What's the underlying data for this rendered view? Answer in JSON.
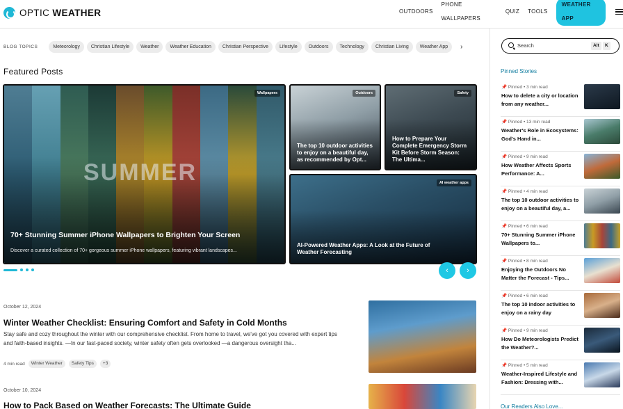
{
  "header": {
    "logo_light": "OPTIC ",
    "logo_bold": "WEATHER",
    "nav": [
      "OUTDOORS",
      "PHONE WALLPAPERS",
      "QUIZ",
      "TOOLS"
    ],
    "cta": "WEATHER APP"
  },
  "topics": {
    "label": "BLOG TOPICS",
    "chips": [
      "Meteorology",
      "Christian Lifestyle",
      "Weather",
      "Weather Education",
      "Christian Perspective",
      "Lifestyle",
      "Outdoors",
      "Technology",
      "Christian Living",
      "Weather App"
    ]
  },
  "featured": {
    "title": "Featured Posts",
    "main": {
      "badge": "Wallpapers",
      "image_word": "SUMMER",
      "title": "70+ Stunning Summer iPhone Wallpapers to Brighten Your Screen",
      "desc": "Discover a curated collection of 70+ gorgeous summer iPhone wallpapers, featuring vibrant landscapes..."
    },
    "card2": {
      "badge": "Outdoors",
      "title": "The top 10 outdoor activities to enjoy on a beautiful day, as recommended by Opt..."
    },
    "card3": {
      "badge": "Safety",
      "title": "How to Prepare Your Complete Emergency Storm Kit Before Storm Season: The Ultima..."
    },
    "card4": {
      "badge": "AI weather apps",
      "title": "AI-Powered Weather Apps: A Look at the Future of Weather Forecasting"
    }
  },
  "posts": [
    {
      "date": "October 12, 2024",
      "title": "Winter Weather Checklist: Ensuring Comfort and Safety in Cold Months",
      "excerpt": "Stay safe and cozy throughout the winter with our comprehensive checklist. From home to travel, we've got you covered with expert tips and faith-based insights. —In our fast-paced society, winter safety often gets overlooked —a dangerous oversight tha...",
      "read": "4 min read",
      "tags": [
        "Winter Weather",
        "Safety Tips"
      ],
      "more": "+3"
    },
    {
      "date": "October 10, 2024",
      "title": "How to Pack Based on Weather Forecasts: The Ultimate Guide"
    }
  ],
  "sidebar": {
    "search_placeholder": "Search",
    "kbd": [
      "Alt",
      "K"
    ],
    "pinned_heading": "Pinned Stories",
    "pinned": [
      {
        "meta": "Pinned • 3 min read",
        "title": "How to delete a city or location from any weather..."
      },
      {
        "meta": "Pinned • 13 min read",
        "title": "Weather's Role in Ecosystems: God's Hand in..."
      },
      {
        "meta": "Pinned • 9 min read",
        "title": "How Weather Affects Sports Performance: A..."
      },
      {
        "meta": "Pinned • 4 min read",
        "title": "The top 10 outdoor activities to enjoy on a beautiful day, a..."
      },
      {
        "meta": "Pinned • 6 min read",
        "title": "70+ Stunning Summer iPhone Wallpapers to..."
      },
      {
        "meta": "Pinned • 8 min read",
        "title": "Enjoying the Outdoors No Matter the Forecast - Tips..."
      },
      {
        "meta": "Pinned • 6 min read",
        "title": "The top 10 indoor activities to enjoy on a rainy day"
      },
      {
        "meta": "Pinned • 9 min read",
        "title": "How Do Meteorologists Predict the Weather?..."
      },
      {
        "meta": "Pinned • 5 min read",
        "title": "Weather-Inspired Lifestyle and Fashion: Dressing with..."
      }
    ],
    "readers_heading": "Our Readers Also Love..."
  },
  "colors": {
    "accent": "#1fc3e0",
    "link": "#137ea0"
  }
}
